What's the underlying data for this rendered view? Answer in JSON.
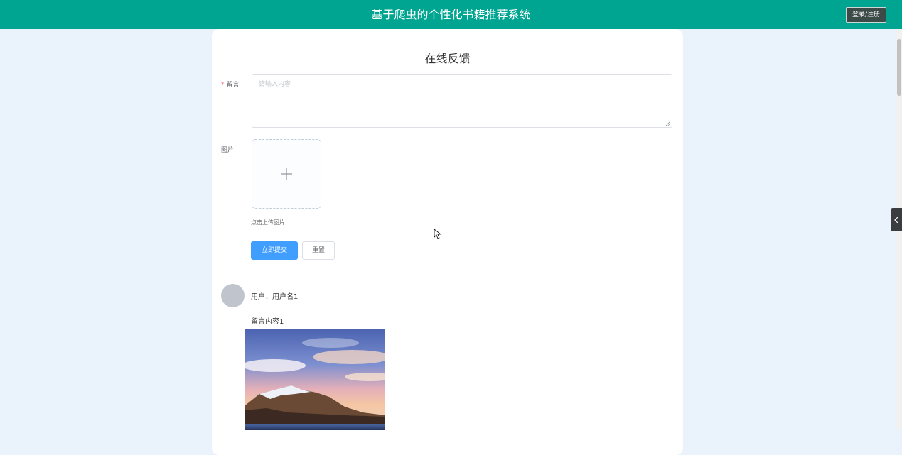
{
  "header": {
    "title": "基于爬虫的个性化书籍推荐系统",
    "login_label": "登录/注册",
    "bg_color": "#00a591"
  },
  "form": {
    "title": "在线反馈",
    "message_label": "留言",
    "required_mark": "*",
    "message_placeholder": "请输入内容",
    "image_label": "图片",
    "upload_icon": "plus-icon",
    "upload_tip": "点击上传图片",
    "submit_label": "立即提交",
    "reset_label": "重置",
    "accent_color": "#409eff"
  },
  "comments": [
    {
      "user_label": "用户：用户名1",
      "content": "留言内容1",
      "image": "mountain-lake-photo"
    }
  ],
  "side_toggle_icon": "chevron-left-icon"
}
